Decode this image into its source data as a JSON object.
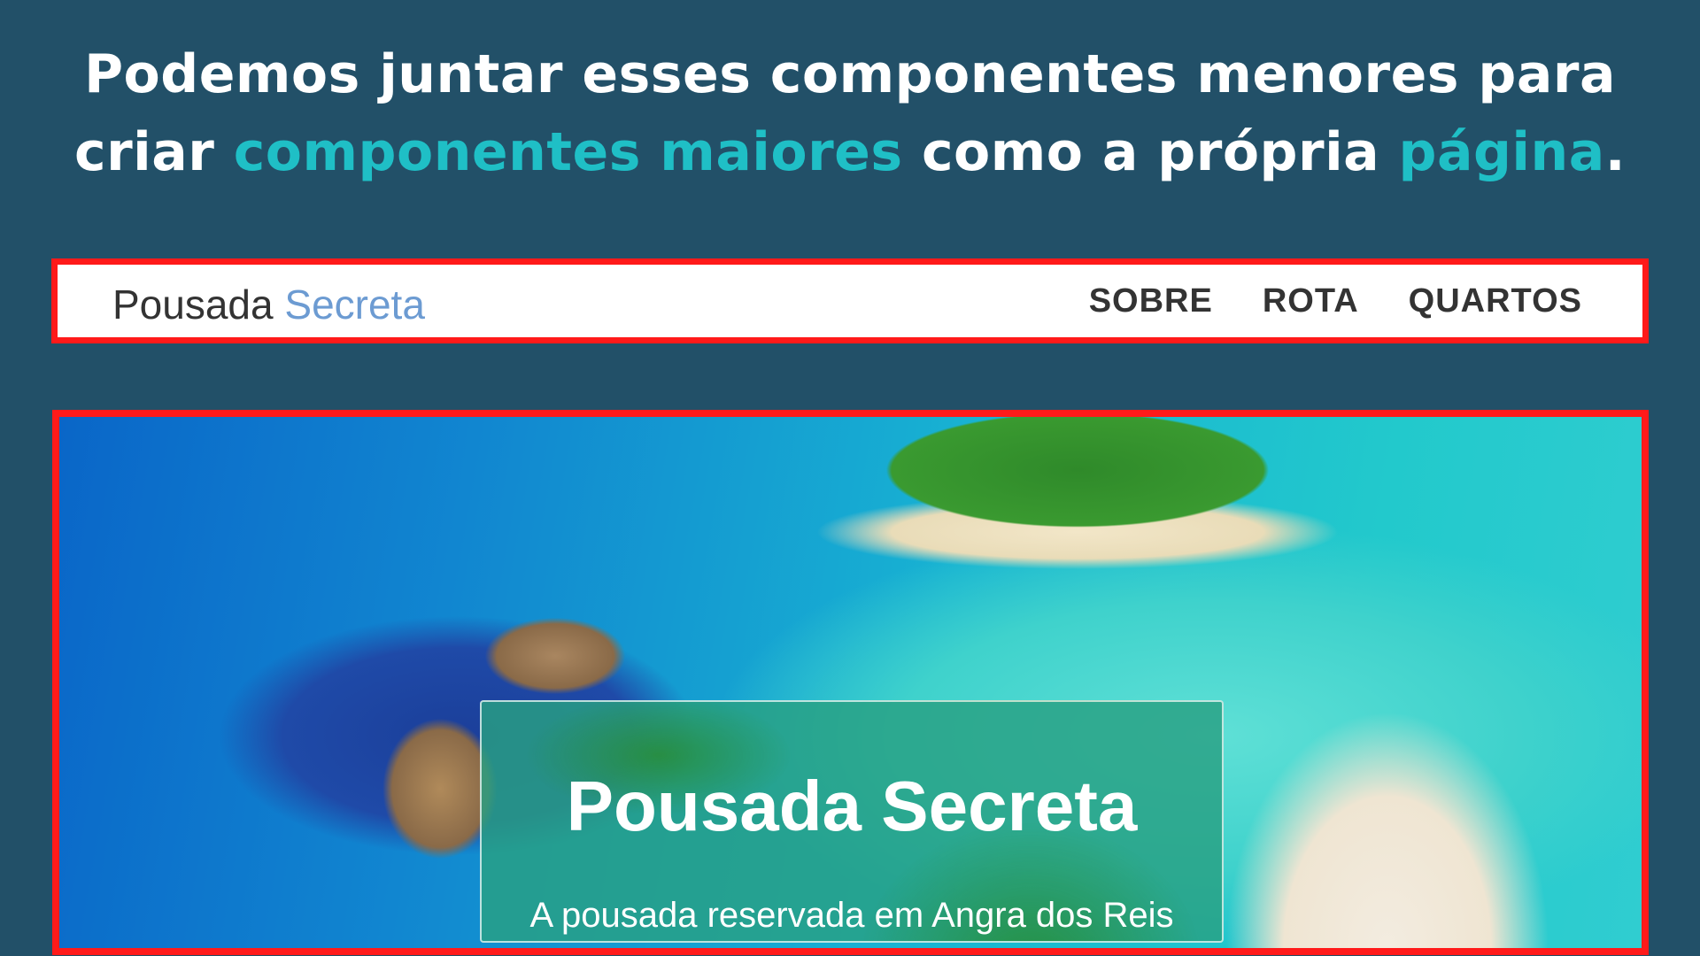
{
  "headline": {
    "line1": "Podemos juntar esses componentes menores para",
    "line2_part1": "criar ",
    "line2_highlight1": "componentes maiores",
    "line2_part2": " como a própria ",
    "line2_highlight2": "página",
    "line2_end": "."
  },
  "navbar": {
    "logo_part1": "Pousada ",
    "logo_part2": "Secreta",
    "items": [
      {
        "label": "SOBRE"
      },
      {
        "label": "ROTA"
      },
      {
        "label": "QUARTOS"
      }
    ]
  },
  "hero": {
    "title": "Pousada Secreta",
    "subtitle": "A pousada reservada em Angra dos Reis"
  },
  "colors": {
    "background": "#225068",
    "highlight": "#1fbfc6",
    "outline": "#ff1a1a",
    "logo_accent": "#6c9bd2"
  }
}
